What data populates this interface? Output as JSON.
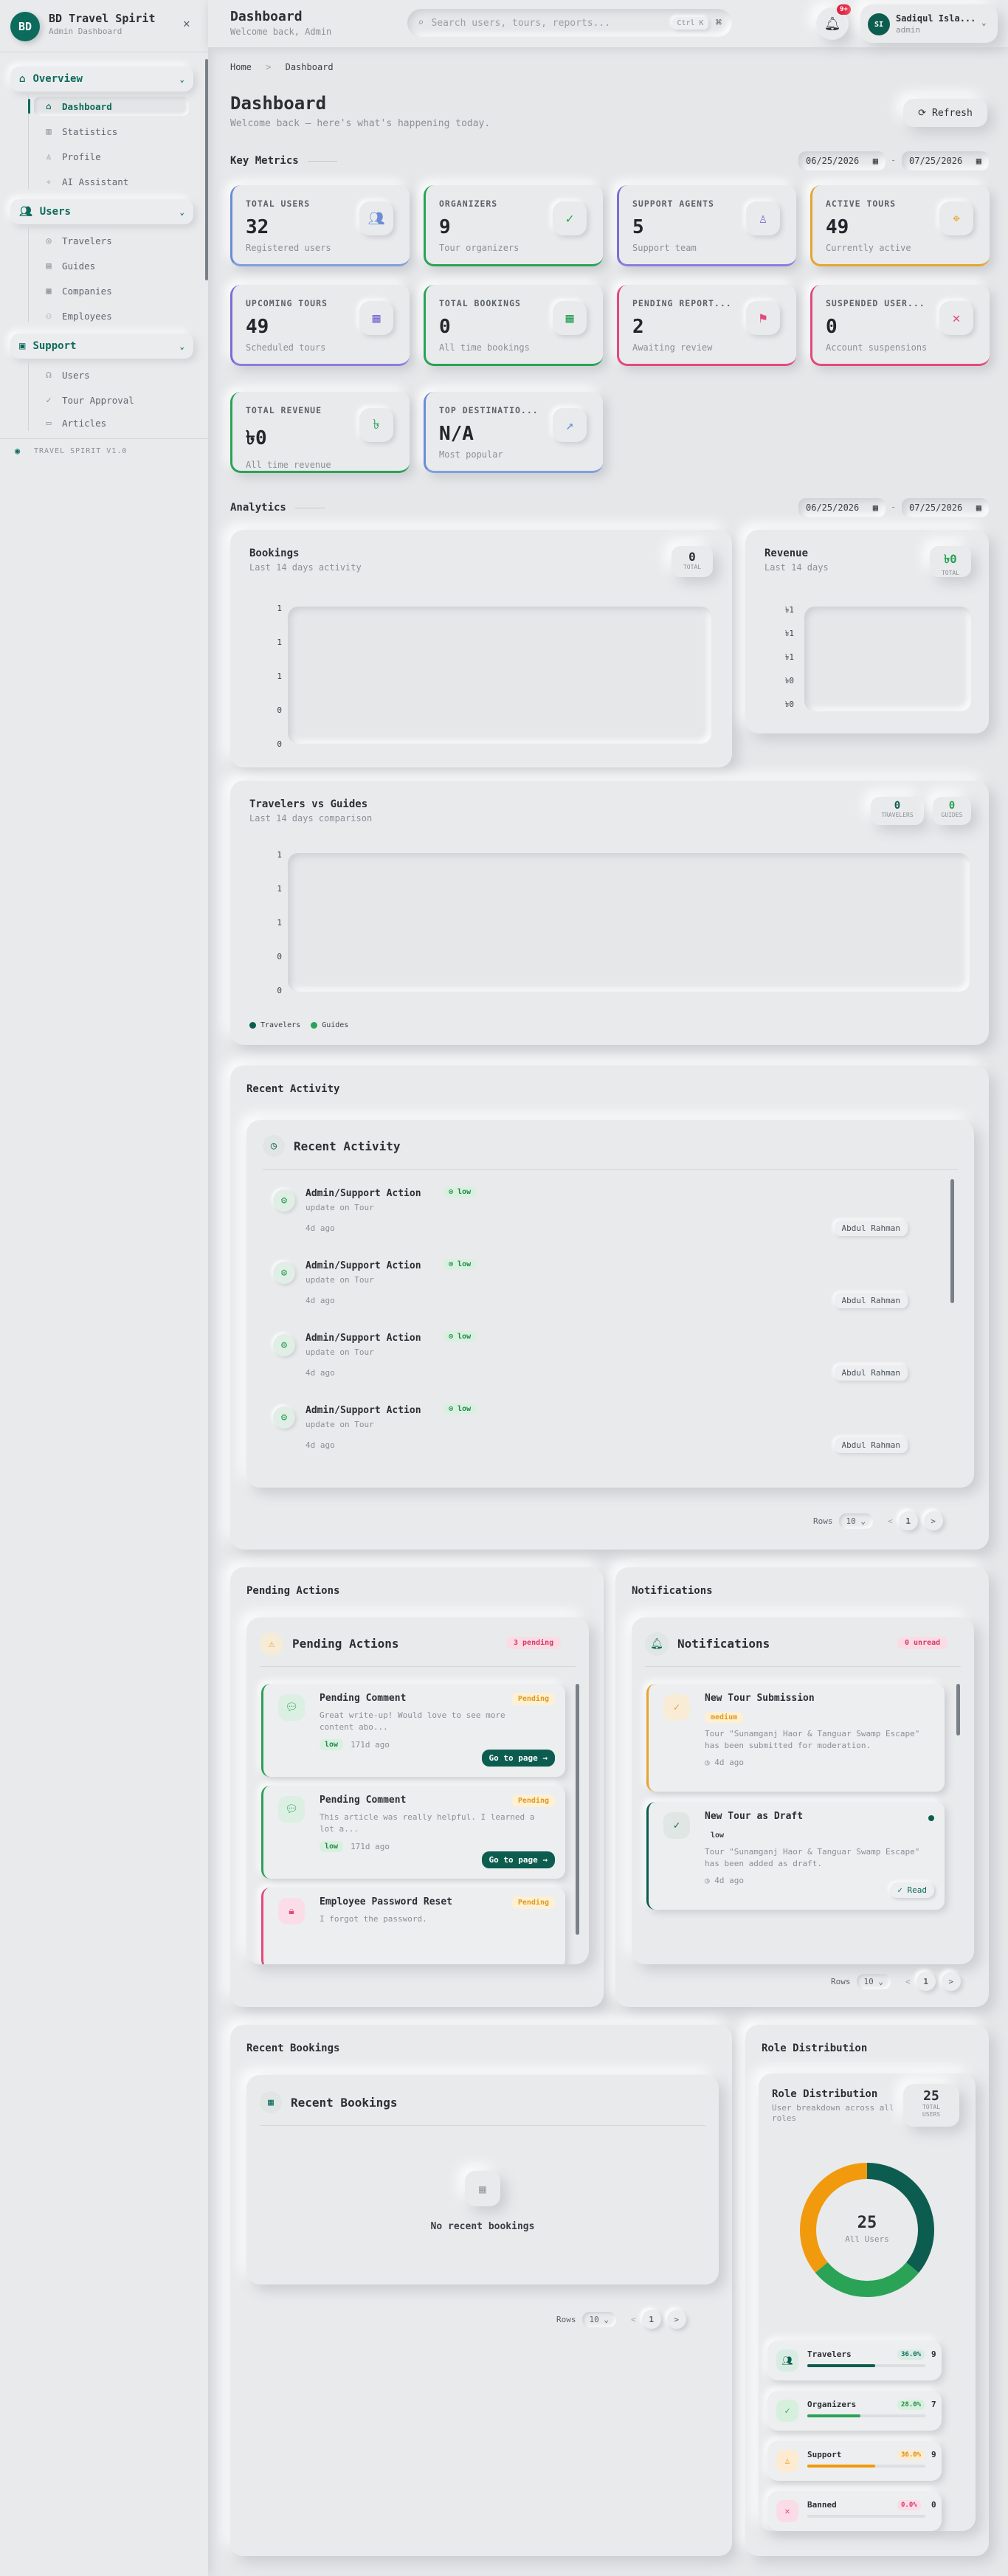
{
  "app": {
    "name": "BD Travel Spirit",
    "subtitle": "Admin Dashboard",
    "logo_initials": "BD",
    "version": "TRAVEL SPIRIT V1.0"
  },
  "sidebar": {
    "sections": [
      {
        "label": "Overview",
        "items": [
          {
            "label": "Dashboard",
            "icon": "home-icon",
            "active": true
          },
          {
            "label": "Statistics",
            "icon": "chart-icon"
          },
          {
            "label": "Profile",
            "icon": "user-icon"
          },
          {
            "label": "AI Assistant",
            "icon": "sparkle-icon"
          }
        ]
      },
      {
        "label": "Users",
        "items": [
          {
            "label": "Travelers",
            "icon": "compass-icon"
          },
          {
            "label": "Guides",
            "icon": "map-icon"
          },
          {
            "label": "Companies",
            "icon": "building-icon"
          },
          {
            "label": "Employees",
            "icon": "team-icon"
          }
        ]
      },
      {
        "label": "Support",
        "items": [
          {
            "label": "Users",
            "icon": "headset-icon"
          },
          {
            "label": "Tour Approval",
            "icon": "check-circle-icon"
          },
          {
            "label": "Articles",
            "icon": "document-icon"
          }
        ]
      }
    ]
  },
  "topbar": {
    "title": "Dashboard",
    "subtitle": "Welcome back, Admin",
    "search_placeholder": "Search users, tours, reports...",
    "search_shortcut": "Ctrl K",
    "notif_count": "9+",
    "user_initials": "SI",
    "user_name": "Sadiqul Isla...",
    "user_role": "admin"
  },
  "breadcrumb": {
    "home": "Home",
    "sep": ">",
    "current": "Dashboard"
  },
  "page": {
    "title": "Dashboard",
    "subtitle": "Welcome back — here's what's happening today.",
    "refresh_label": "Refresh"
  },
  "key_metrics": {
    "title": "Key Metrics",
    "date_from": "06/25/2026",
    "date_to": "07/25/2026",
    "date_sep": "-",
    "cards": [
      {
        "label": "TOTAL USERS",
        "value": "32",
        "sub": "Registered users",
        "icon": "users-icon",
        "color": "#6b8dd6"
      },
      {
        "label": "ORGANIZERS",
        "value": "9",
        "sub": "Tour organizers",
        "icon": "user-check-icon",
        "color": "#2aa357"
      },
      {
        "label": "SUPPORT AGENTS",
        "value": "5",
        "sub": "Support team",
        "icon": "user-icon",
        "color": "#7f6bd6"
      },
      {
        "label": "ACTIVE TOURS",
        "value": "49",
        "sub": "Currently active",
        "icon": "map-pin-icon",
        "color": "#e5a530"
      },
      {
        "label": "UPCOMING TOURS",
        "value": "49",
        "sub": "Scheduled tours",
        "icon": "calendar-icon",
        "color": "#7f6bd6"
      },
      {
        "label": "TOTAL BOOKINGS",
        "value": "0",
        "sub": "All time bookings",
        "icon": "calendar-check-icon",
        "color": "#2aa357"
      },
      {
        "label": "PENDING REPORT...",
        "value": "2",
        "sub": "Awaiting review",
        "icon": "flag-icon",
        "color": "#e24a7a"
      },
      {
        "label": "SUSPENDED USER...",
        "value": "0",
        "sub": "Account suspensions",
        "icon": "user-x-icon",
        "color": "#e24a7a"
      },
      {
        "label": "TOTAL REVENUE",
        "value": "৳0",
        "sub": "All time revenue",
        "icon": "taka-icon",
        "color": "#2aa357"
      },
      {
        "label": "TOP DESTINATIO...",
        "value": "N/A",
        "sub": "Most popular",
        "icon": "trend-up-icon",
        "color": "#6b8dd6"
      }
    ]
  },
  "analytics": {
    "title": "Analytics",
    "date_from": "06/25/2026",
    "date_to": "07/25/2026",
    "date_sep": "-",
    "bookings": {
      "title": "Bookings",
      "subtitle": "Last 14 days activity",
      "total": "0",
      "total_label": "TOTAL",
      "y_ticks": [
        "1",
        "1",
        "1",
        "0",
        "0"
      ]
    },
    "revenue": {
      "title": "Revenue",
      "subtitle": "Last 14 days",
      "total": "৳0",
      "total_label": "TOTAL",
      "y_ticks": [
        "৳1",
        "৳1",
        "৳1",
        "৳0",
        "৳0"
      ]
    },
    "travelers_guides": {
      "title": "Travelers vs Guides",
      "subtitle": "Last 14 days comparison",
      "travelers": "0",
      "travelers_label": "TRAVELERS",
      "guides": "0",
      "guides_label": "GUIDES",
      "y_ticks": [
        "1",
        "1",
        "1",
        "0",
        "0"
      ],
      "legend": [
        "Travelers",
        "Guides"
      ],
      "legend_colors": [
        "#0c5d4f",
        "#2aa357"
      ]
    }
  },
  "recent_activity": {
    "outer_title": "Recent Activity",
    "title": "Recent Activity",
    "items": [
      {
        "title": "Admin/Support Action",
        "tag": "low",
        "desc": "update on Tour",
        "time": "4d ago",
        "author": "Abdul Rahman"
      },
      {
        "title": "Admin/Support Action",
        "tag": "low",
        "desc": "update on Tour",
        "time": "4d ago",
        "author": "Abdul Rahman"
      },
      {
        "title": "Admin/Support Action",
        "tag": "low",
        "desc": "update on Tour",
        "time": "4d ago",
        "author": "Abdul Rahman"
      },
      {
        "title": "Admin/Support Action",
        "tag": "low",
        "desc": "update on Tour",
        "time": "4d ago",
        "author": "Abdul Rahman"
      }
    ],
    "pager": {
      "rows_label": "Rows",
      "rows": "10",
      "page": "1",
      "prev": "<",
      "next": ">"
    }
  },
  "pending_actions": {
    "outer_title": "Pending Actions",
    "title": "Pending Actions",
    "count_badge": "3 pending",
    "items": [
      {
        "title": "Pending Comment",
        "status": "Pending",
        "desc": "Great write-up! Would love to see more content abo...",
        "tag": "low",
        "time": "171d ago",
        "action": "Go to page →",
        "color": "#2aa357",
        "icon": "comment-icon"
      },
      {
        "title": "Pending Comment",
        "status": "Pending",
        "desc": "This article was really helpful. I learned a lot a...",
        "tag": "low",
        "time": "171d ago",
        "action": "Go to page →",
        "color": "#2aa357",
        "icon": "comment-icon"
      },
      {
        "title": "Employee Password Reset",
        "status": "Pending",
        "desc": "I forgot the password.",
        "color": "#e24a7a",
        "icon": "lock-icon"
      }
    ]
  },
  "notifications": {
    "outer_title": "Notifications",
    "title": "Notifications",
    "count_badge": "0 unread",
    "items": [
      {
        "title": "New Tour Submission",
        "priority": "medium",
        "desc": "Tour \"Sunamganj Haor & Tanguar Swamp Escape\" has been submitted for moderation.",
        "time": "4d ago",
        "color": "#e5a530"
      },
      {
        "title": "New Tour as Draft",
        "priority": "low",
        "desc": "Tour \"Sunamganj Haor & Tanguar Swamp Escape\" has been added as draft.",
        "time": "4d ago",
        "action": "✓ Read",
        "color": "#0c5d4f"
      }
    ],
    "pager": {
      "rows_label": "Rows",
      "rows": "10",
      "page": "1",
      "prev": "<",
      "next": ">"
    }
  },
  "recent_bookings": {
    "outer_title": "Recent Bookings",
    "title": "Recent Bookings",
    "empty": "No recent bookings",
    "pager": {
      "rows_label": "Rows",
      "rows": "10",
      "page": "1",
      "prev": "<",
      "next": ">"
    }
  },
  "role_distribution": {
    "outer_title": "Role Distribution",
    "title": "Role Distribution",
    "subtitle": "User breakdown across all roles",
    "total": "25",
    "total_label": "TOTAL USERS",
    "center_value": "25",
    "center_label": "All Users",
    "roles": [
      {
        "name": "Travelers",
        "pct": "36.0%",
        "count": "9",
        "fraction": 0.36,
        "color": "#0c5d4f",
        "badge_bg": "#d9ece4",
        "badge_color": "#0c6b5c",
        "icon": "users-icon"
      },
      {
        "name": "Organizers",
        "pct": "28.0%",
        "count": "7",
        "fraction": 0.28,
        "color": "#2aa357",
        "badge_bg": "#d7f0de",
        "badge_color": "#1f8a45",
        "icon": "user-check-icon"
      },
      {
        "name": "Support",
        "pct": "36.0%",
        "count": "9",
        "fraction": 0.36,
        "color": "#f19a0d",
        "badge_bg": "#fcebd0",
        "badge_color": "#d98a08",
        "icon": "user-icon"
      },
      {
        "name": "Banned",
        "pct": "0.0%",
        "count": "0",
        "fraction": 0.0,
        "color": "#e24a7a",
        "badge_bg": "#fbdce6",
        "badge_color": "#d23b6b",
        "icon": "user-x-icon"
      }
    ]
  }
}
